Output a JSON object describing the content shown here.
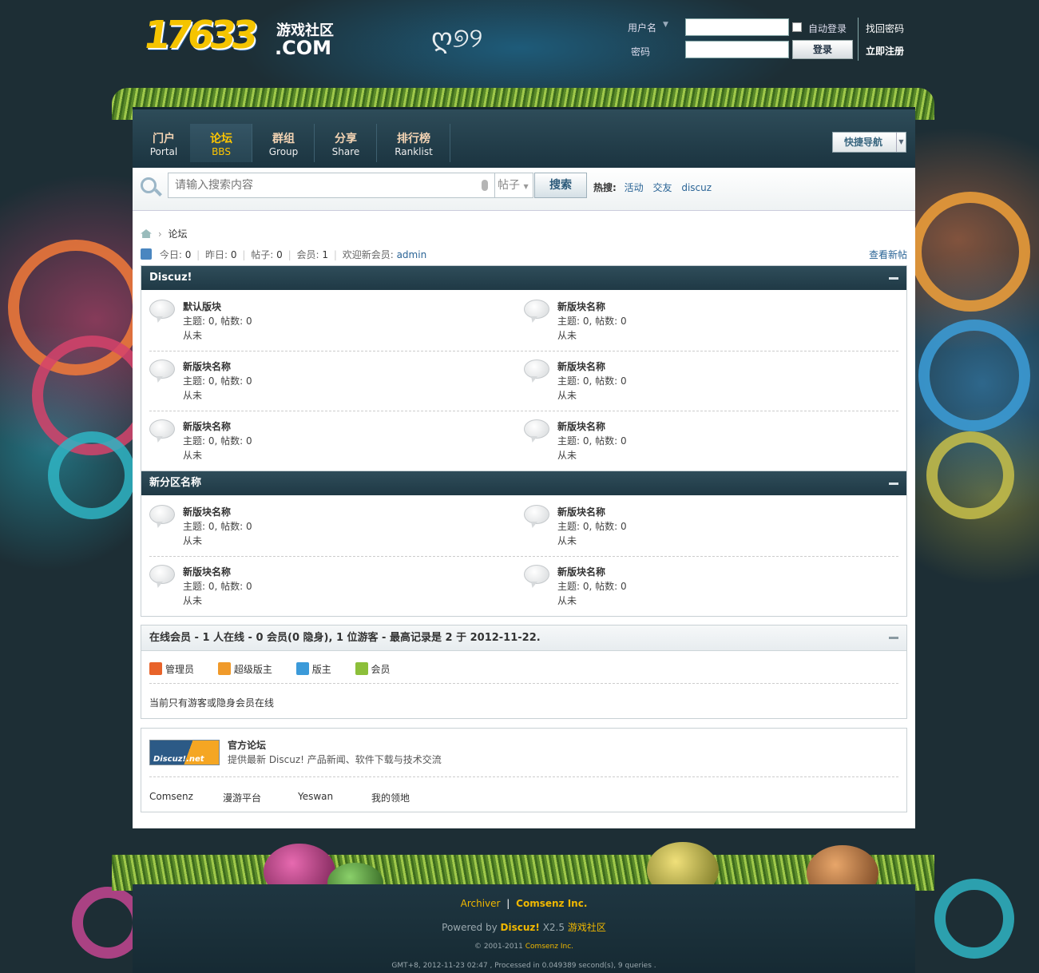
{
  "header": {
    "logo_number": "17633",
    "logo_cn": "游戏社区",
    "logo_com": ".COM"
  },
  "login": {
    "username_label": "用户名",
    "password_label": "密码",
    "auto_login_label": "自动登录",
    "login_button": "登录",
    "forgot_password": "找回密码",
    "register": "立即注册"
  },
  "nav": {
    "items": [
      {
        "cn": "门户",
        "en": "Portal"
      },
      {
        "cn": "论坛",
        "en": "BBS"
      },
      {
        "cn": "群组",
        "en": "Group"
      },
      {
        "cn": "分享",
        "en": "Share"
      },
      {
        "cn": "排行榜",
        "en": "Ranklist"
      }
    ],
    "quick_nav": "快捷导航"
  },
  "search": {
    "placeholder": "请输入搜索内容",
    "type": "帖子",
    "button": "搜索",
    "hot_label": "热搜:",
    "hot_items": [
      "活动",
      "交友",
      "discuz"
    ]
  },
  "breadcrumb": {
    "separator": "›",
    "current": "论坛"
  },
  "stats": {
    "today_label": "今日:",
    "today": "0",
    "yesterday_label": "昨日:",
    "yesterday": "0",
    "posts_label": "帖子:",
    "posts": "0",
    "members_label": "会员:",
    "members": "1",
    "welcome_label": "欢迎新会员:",
    "welcome_user": "admin",
    "new_posts": "查看新帖"
  },
  "sections": [
    {
      "title": "Discuz!",
      "forums": [
        {
          "name": "默认版块",
          "meta": "主题: 0, 帖数: 0",
          "last": "从未"
        },
        {
          "name": "新版块名称",
          "meta": "主题: 0, 帖数: 0",
          "last": "从未"
        },
        {
          "name": "新版块名称",
          "meta": "主题: 0, 帖数: 0",
          "last": "从未"
        },
        {
          "name": "新版块名称",
          "meta": "主题: 0, 帖数: 0",
          "last": "从未"
        },
        {
          "name": "新版块名称",
          "meta": "主题: 0, 帖数: 0",
          "last": "从未"
        },
        {
          "name": "新版块名称",
          "meta": "主题: 0, 帖数: 0",
          "last": "从未"
        }
      ]
    },
    {
      "title": "新分区名称",
      "forums": [
        {
          "name": "新版块名称",
          "meta": "主题: 0, 帖数: 0",
          "last": "从未"
        },
        {
          "name": "新版块名称",
          "meta": "主题: 0, 帖数: 0",
          "last": "从未"
        },
        {
          "name": "新版块名称",
          "meta": "主题: 0, 帖数: 0",
          "last": "从未"
        },
        {
          "name": "新版块名称",
          "meta": "主题: 0, 帖数: 0",
          "last": "从未"
        }
      ]
    }
  ],
  "online": {
    "title": "在线会员 - 1 人在线 - 0 会员(0 隐身), 1 位游客 - 最高记录是 2 于 2012-11-22.",
    "legend": [
      {
        "label": "管理员",
        "color": "#e8632a"
      },
      {
        "label": "超级版主",
        "color": "#f09a2a"
      },
      {
        "label": "版主",
        "color": "#3b9ad9"
      },
      {
        "label": "会员",
        "color": "#8cbf3a"
      }
    ],
    "status": "当前只有游客或隐身会员在线"
  },
  "links": {
    "logo_text": "Discuz!.net",
    "title": "官方论坛",
    "desc": "提供最新 Discuz! 产品新闻、软件下载与技术交流",
    "items": [
      "Comsenz",
      "漫游平台",
      "Yeswan",
      "我的领地"
    ]
  },
  "footer": {
    "archiver": "Archiver",
    "sep": "|",
    "company": "Comsenz Inc.",
    "powered_prefix": "Powered by",
    "powered_brand": "Discuz!",
    "version": "X2.5",
    "site": "游戏社区",
    "copyright_prefix": "© 2001-2011",
    "copyright_company": "Comsenz Inc.",
    "debug": "GMT+8, 2012-11-23 02:47 , Processed in 0.049389 second(s), 9 queries ."
  }
}
